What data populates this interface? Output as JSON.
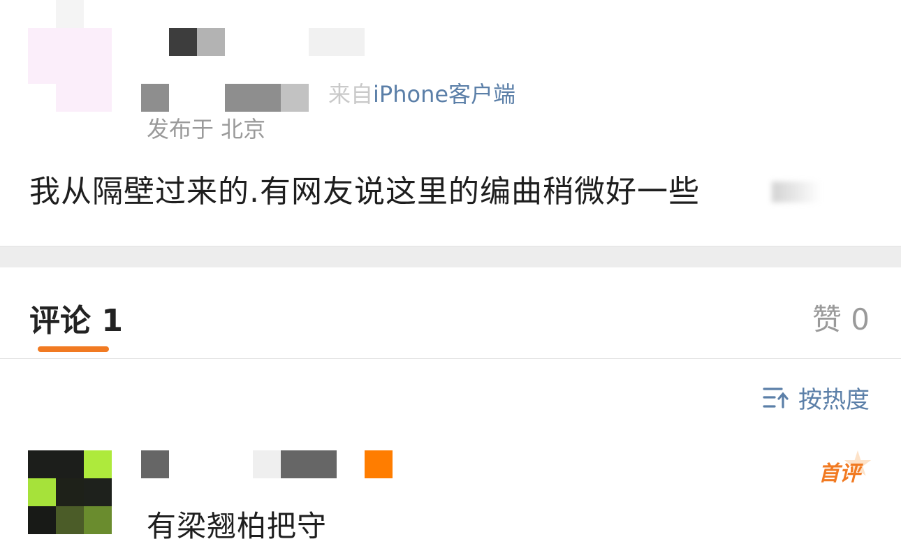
{
  "post": {
    "source_prefix": "来自",
    "source_client": "iPhone客户端",
    "location": "发布于 北京",
    "text": "我从隔壁过来的.有网友说这里的编曲稍微好一些"
  },
  "tabs": {
    "comments_label": "评论 1",
    "likes_label": "赞 0"
  },
  "sort": {
    "label": "按热度",
    "icon": "sort-by-hot-icon"
  },
  "comment": {
    "text": "有梁翘柏把守",
    "badge": "首评"
  },
  "colors": {
    "accent": "#f17a22",
    "link": "#5b7fa8",
    "muted": "#9a9a9a",
    "divider": "#ededed"
  }
}
